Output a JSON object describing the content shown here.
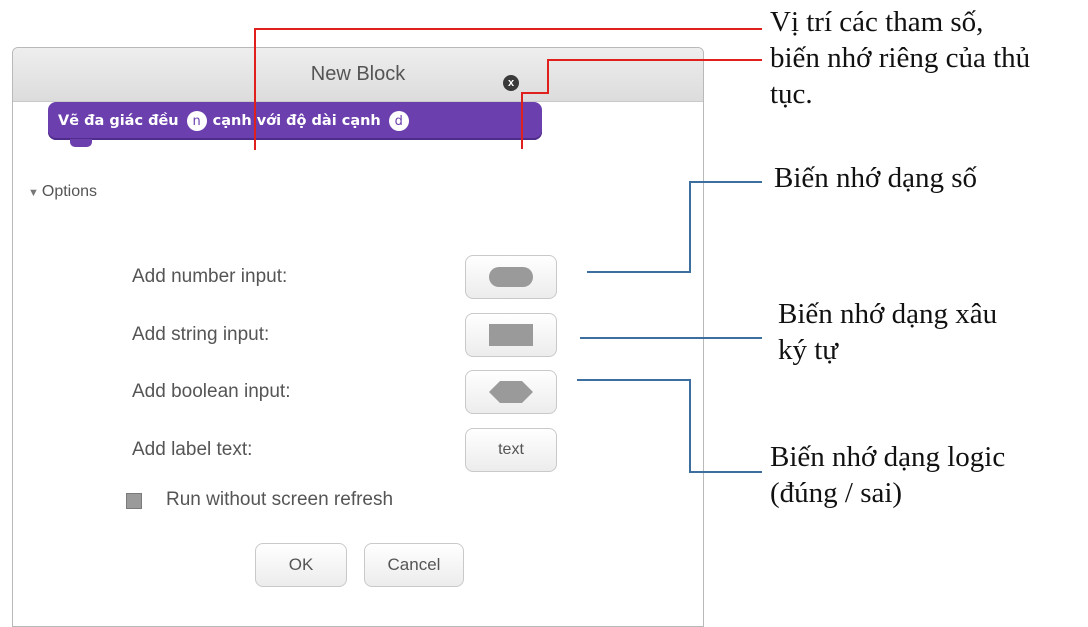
{
  "dialog": {
    "title": "New Block",
    "block": {
      "text1": "Vẽ đa giác đều",
      "param1": "n",
      "text2": "cạnh với độ dài cạnh",
      "param2": "d",
      "delete_icon": "x"
    },
    "options_label": "Options",
    "options": [
      {
        "label": "Add number input:",
        "shape": "rounded-rect"
      },
      {
        "label": "Add string input:",
        "shape": "rectangle"
      },
      {
        "label": "Add boolean input:",
        "shape": "hexagon"
      },
      {
        "label": "Add label text:",
        "button_text": "text"
      }
    ],
    "run_without_refresh": {
      "label": "Run without screen refresh",
      "checked": false
    },
    "ok_label": "OK",
    "cancel_label": "Cancel"
  },
  "annotations": {
    "params": [
      "Vị trí các tham số,",
      "biến nhớ riêng của thủ",
      "tục."
    ],
    "number": "Biến nhớ dạng số",
    "string": [
      "Biến nhớ dạng xâu",
      "ký tự"
    ],
    "boolean": [
      "Biến nhớ dạng logic",
      "(đúng / sai)"
    ]
  },
  "colors": {
    "block": "#6b3fae",
    "leader_red": "#e0201c",
    "leader_blue": "#3c6e9e"
  }
}
